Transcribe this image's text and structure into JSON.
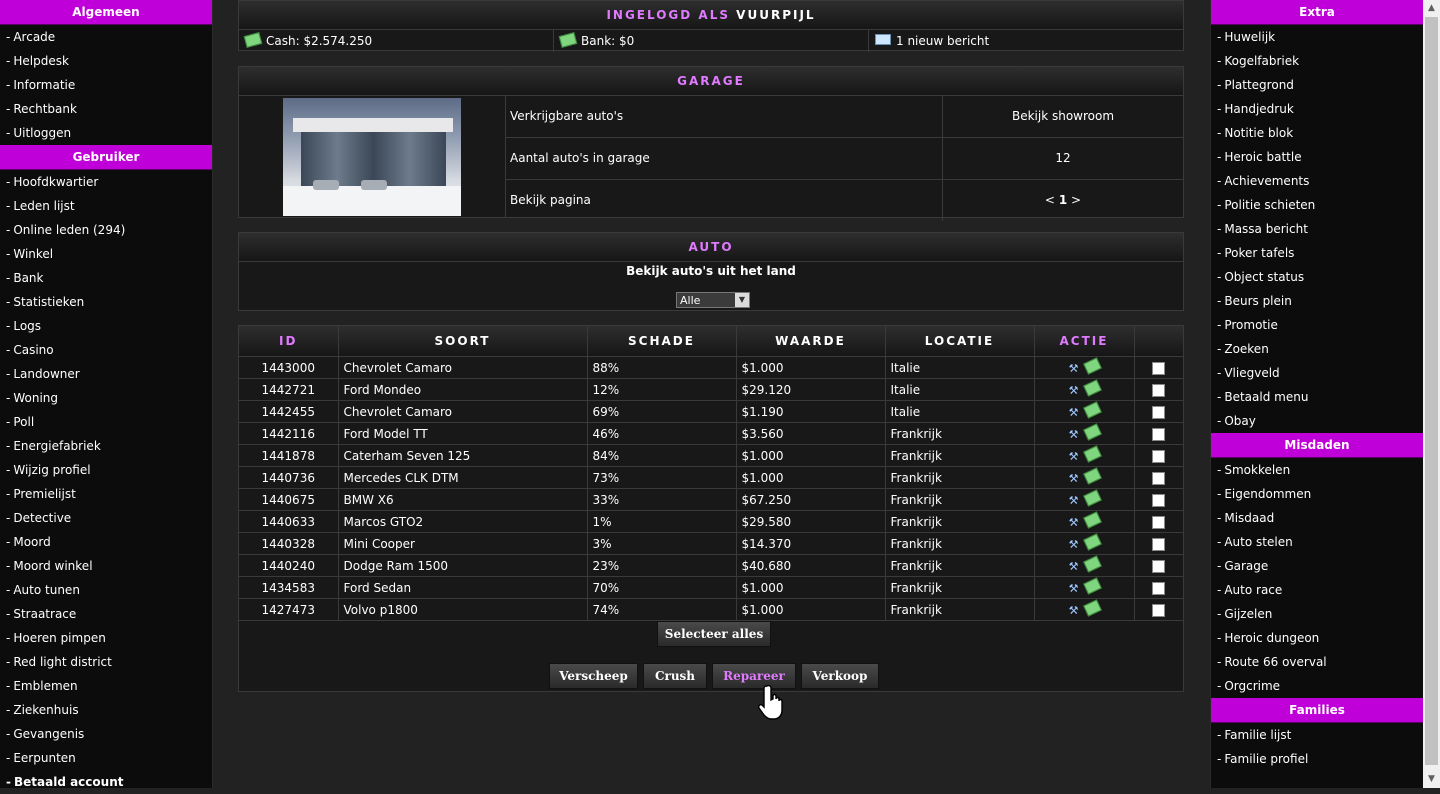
{
  "left_sidebar": {
    "sections": [
      {
        "title": "Algemeen",
        "items": [
          "Arcade",
          "Helpdesk",
          "Informatie",
          "Rechtbank",
          "Uitloggen"
        ]
      },
      {
        "title": "Gebruiker",
        "items": [
          "Hoofdkwartier",
          "Leden lijst",
          "Online leden (294)",
          "Winkel",
          "Bank",
          "Statistieken",
          "Logs",
          "Casino",
          "Landowner",
          "Woning",
          "Poll",
          "Energiefabriek",
          "Wijzig profiel",
          "Premielijst",
          "Detective",
          "Moord",
          "Moord winkel",
          "Auto tunen",
          "Straatrace",
          "Hoeren pimpen",
          "Red light district",
          "Emblemen",
          "Ziekenhuis",
          "Gevangenis",
          "Eerpunten"
        ]
      }
    ],
    "cutoff_item": "Betaald account"
  },
  "right_sidebar": {
    "sections": [
      {
        "title": "Extra",
        "items": [
          "Huwelijk",
          "Kogelfabriek",
          "Plattegrond",
          "Handjedruk",
          "Notitie blok",
          "Heroic battle",
          "Achievements",
          "Politie schieten",
          "Massa bericht",
          "Poker tafels",
          "Object status",
          "Beurs plein",
          "Promotie",
          "Zoeken",
          "Vliegveld",
          "Betaald menu",
          "Obay"
        ]
      },
      {
        "title": "Misdaden",
        "items": [
          "Smokkelen",
          "Eigendommen",
          "Misdaad",
          "Auto stelen",
          "Garage",
          "Auto race",
          "Gijzelen",
          "Heroic dungeon",
          "Route 66 overval",
          "Orgcrime"
        ]
      },
      {
        "title": "Families",
        "items": [
          "Familie lijst",
          "Familie profiel"
        ]
      }
    ]
  },
  "header": {
    "logged_in_prefix": "INGELOGD ALS",
    "username": "VUURPIJL",
    "cash": "Cash: $2.574.250",
    "bank": "Bank: $0",
    "messages": "1 nieuw bericht"
  },
  "garage": {
    "title": "GARAGE",
    "rows": [
      {
        "label": "Verkrijgbare auto's",
        "value": "Bekijk showroom"
      },
      {
        "label": "Aantal auto's in garage",
        "value": "12"
      },
      {
        "label": "Bekijk pagina",
        "value": ""
      }
    ],
    "pager": {
      "prev": "<",
      "current": "1",
      "next": ">"
    }
  },
  "auto": {
    "title": "AUTO",
    "filter_label": "Bekijk auto's uit het land",
    "selected_country": "Alle"
  },
  "table": {
    "headers": [
      "ID",
      "SOORT",
      "SCHADE",
      "WAARDE",
      "LOCATIE",
      "ACTIE",
      ""
    ],
    "rows": [
      [
        "1443000",
        "Chevrolet Camaro",
        "88%",
        "$1.000",
        "Italie"
      ],
      [
        "1442721",
        "Ford Mondeo",
        "12%",
        "$29.120",
        "Italie"
      ],
      [
        "1442455",
        "Chevrolet Camaro",
        "69%",
        "$1.190",
        "Italie"
      ],
      [
        "1442116",
        "Ford Model TT",
        "46%",
        "$3.560",
        "Frankrijk"
      ],
      [
        "1441878",
        "Caterham Seven 125",
        "84%",
        "$1.000",
        "Frankrijk"
      ],
      [
        "1440736",
        "Mercedes CLK DTM",
        "73%",
        "$1.000",
        "Frankrijk"
      ],
      [
        "1440675",
        "BMW X6",
        "33%",
        "$67.250",
        "Frankrijk"
      ],
      [
        "1440633",
        "Marcos GTO2",
        "1%",
        "$29.580",
        "Frankrijk"
      ],
      [
        "1440328",
        "Mini Cooper",
        "3%",
        "$14.370",
        "Frankrijk"
      ],
      [
        "1440240",
        "Dodge Ram 1500",
        "23%",
        "$40.680",
        "Frankrijk"
      ],
      [
        "1434583",
        "Ford Sedan",
        "70%",
        "$1.000",
        "Frankrijk"
      ],
      [
        "1427473",
        "Volvo p1800",
        "74%",
        "$1.000",
        "Frankrijk"
      ]
    ]
  },
  "buttons": {
    "select_all": "Selecteer alles",
    "ship": "Verscheep",
    "crush": "Crush",
    "repair": "Repareer",
    "sell": "Verkoop"
  },
  "colors": {
    "accent": "#e07aff",
    "sidebar_header": "#c000d8",
    "background": "#222222"
  }
}
